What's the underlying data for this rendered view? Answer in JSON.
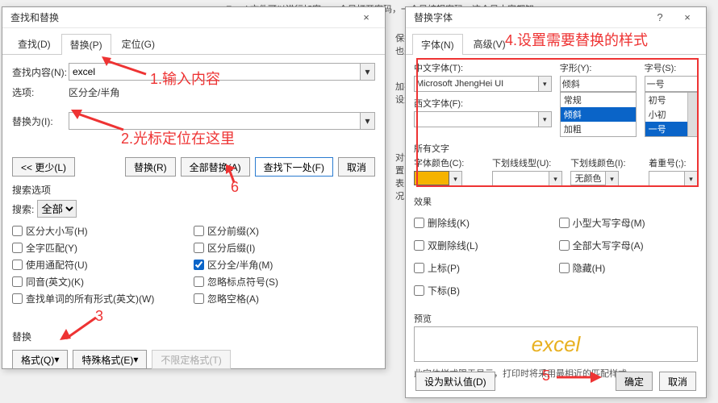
{
  "bg": {
    "l1": "Excel 文件可以进行加密，一个是打开密码，一个是编辑密码，这个是大家都知",
    "l2": "保护",
    "l3": "也是",
    "l4": "加密",
    "l5": "设置",
    "l6": "对设",
    "l7": "置的",
    "l8": "表的",
    "l9": "况，"
  },
  "dlg1": {
    "title": "查找和替换",
    "tabs": {
      "find": "查找(D)",
      "replace": "替换(P)",
      "goto": "定位(G)"
    },
    "findLabel": "查找内容(N):",
    "findValue": "excel",
    "optLabel": "选项:",
    "optValue": "区分全/半角",
    "replaceLabel": "替换为(I):",
    "less": "<< 更少(L)",
    "replaceBtn": "替换(R)",
    "replaceAllBtn": "全部替换(A)",
    "findNextBtn": "查找下一处(F)",
    "cancelBtn": "取消",
    "searchOpts": "搜索选项",
    "searchLabel": "搜索:",
    "searchSel": "全部",
    "chk": {
      "case": "区分大小写(H)",
      "whole": "全字匹配(Y)",
      "wildcard": "使用通配符(U)",
      "homonym": "同音(英文)(K)",
      "allforms": "查找单词的所有形式(英文)(W)",
      "prefix": "区分前缀(X)",
      "suffix": "区分后缀(I)",
      "fullhalf": "区分全/半角(M)",
      "punct": "忽略标点符号(S)",
      "space": "忽略空格(A)"
    },
    "replaceSection": "替换",
    "formatBtn": "格式(Q)",
    "specialBtn": "特殊格式(E)",
    "noFormatBtn": "不限定格式(T)"
  },
  "dlg2": {
    "title": "替换字体",
    "tabs": {
      "font": "字体(N)",
      "adv": "高级(V)"
    },
    "zhFontLbl": "中文字体(T):",
    "zhFontVal": "Microsoft JhengHei UI",
    "enFontLbl": "西文字体(F):",
    "styleLbl": "字形(Y):",
    "styleVal": "倾斜",
    "styleList": [
      "常规",
      "倾斜",
      "加粗"
    ],
    "sizeLbl": "字号(S):",
    "sizeVal": "一号",
    "sizeList": [
      "初号",
      "小初",
      "一号"
    ],
    "allText": "所有文字",
    "fontColorLbl": "字体颜色(C):",
    "ulStyleLbl": "下划线线型(U):",
    "ulColorLbl": "下划线颜色(I):",
    "ulColorVal": "无颜色",
    "emphLbl": "着重号(;):",
    "effectsLbl": "效果",
    "fx": {
      "strike": "删除线(K)",
      "dstrike": "双删除线(L)",
      "super": "上标(P)",
      "sub": "下标(B)",
      "smallcaps": "小型大写字母(M)",
      "allcaps": "全部大写字母(A)",
      "hidden": "隐藏(H)"
    },
    "previewLbl": "预览",
    "previewText": "excel",
    "note": "此字体样式限于显示，打印时将采用最相近的匹配样式。",
    "defaultBtn": "设为默认值(D)",
    "okBtn": "确定",
    "cancelBtn": "取消"
  },
  "ann": {
    "a1": "1.输入内容",
    "a2": "2.光标定位在这里",
    "a3": "3",
    "a4": "4.设置需要替换的样式",
    "a5": "5",
    "a6": "6"
  }
}
